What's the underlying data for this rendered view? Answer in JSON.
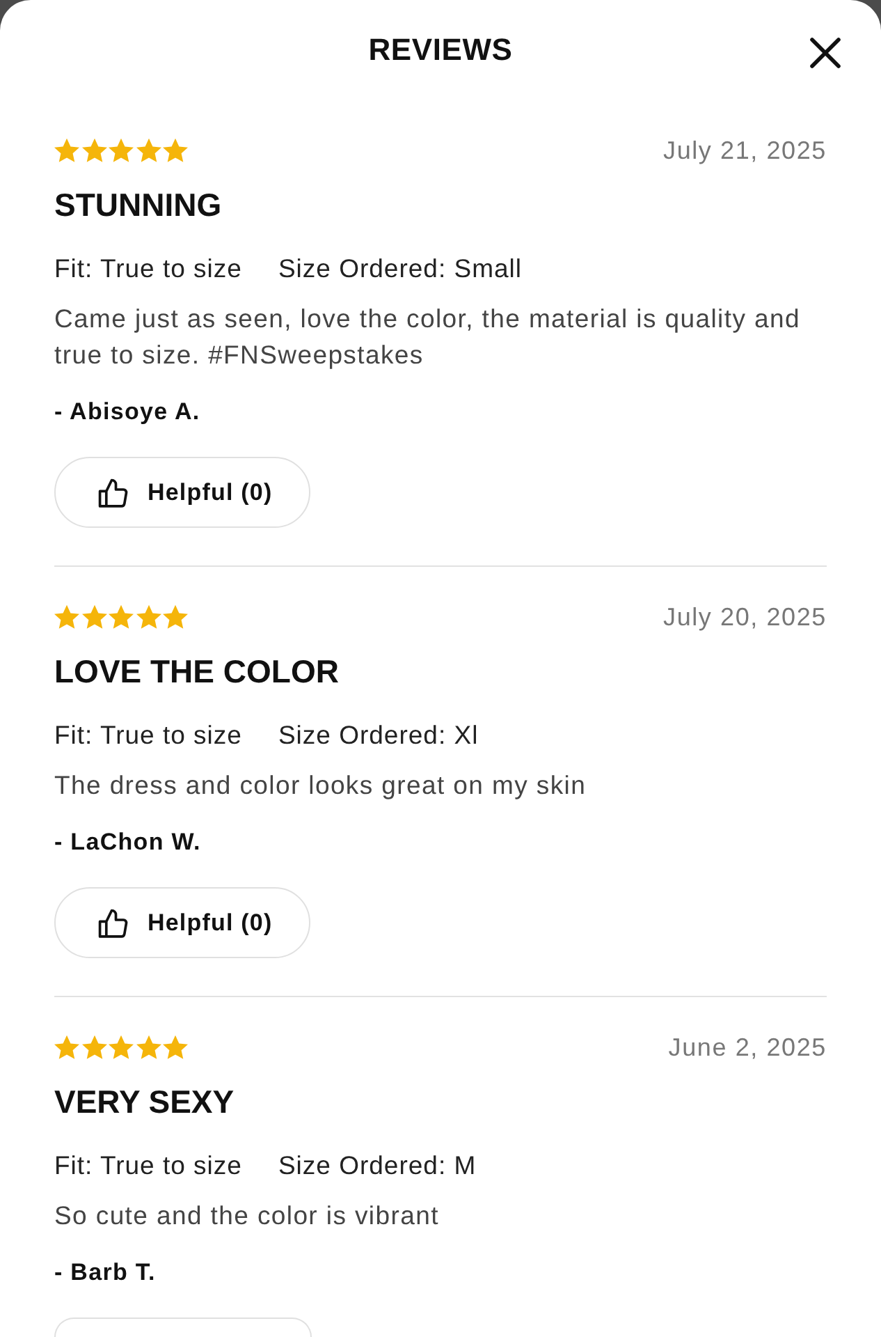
{
  "header": {
    "title": "REVIEWS"
  },
  "reviews": [
    {
      "stars": 5,
      "date": "July 21, 2025",
      "title": "STUNNING",
      "fit": "Fit: True to size",
      "size_ordered": "Size Ordered: Small",
      "body": "Came just as seen, love the color, the material is quality and true to size. #FNSweepstakes",
      "author": "- Abisoye A.",
      "helpful_button": {
        "label": "Helpful (0)",
        "cut_off": false
      }
    },
    {
      "stars": 5,
      "date": "July 20, 2025",
      "title": "LOVE THE COLOR",
      "fit": "Fit: True to size",
      "size_ordered": "Size Ordered: Xl",
      "body": "The dress and color looks great on my skin",
      "author": "- LaChon W.",
      "helpful_button": {
        "label": "Helpful (0)",
        "cut_off": false
      }
    },
    {
      "stars": 5,
      "date": "June 2, 2025",
      "title": "VERY SEXY",
      "fit": "Fit: True to size",
      "size_ordered": "Size Ordered: M",
      "body": "So cute and the color is vibrant",
      "author": "- Barb T.",
      "helpful_button": {
        "cut_off": true
      }
    }
  ]
}
